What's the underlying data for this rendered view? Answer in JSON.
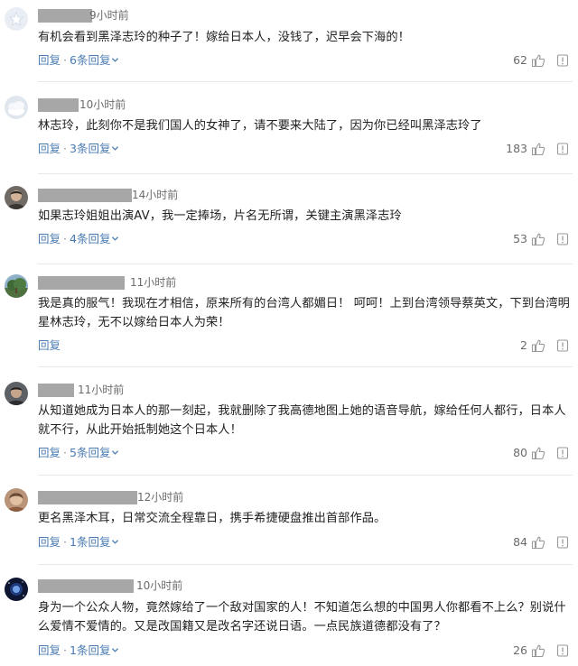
{
  "icons": {
    "like": "thumbs-up-icon",
    "report": "report-flag-icon",
    "expand": "chevron-down-icon"
  },
  "colors": {
    "link": "#4a7bb2",
    "name_mask": "#a7a7a7",
    "muted": "#6b6b6b"
  },
  "comments": [
    {
      "time": "9小时前",
      "text": "有机会看到黑泽志玲的种子了！嫁给日本人，没钱了，迟早会下海的！",
      "reply": "回复",
      "replies": "6条回复",
      "likes": "62"
    },
    {
      "time": "10小时前",
      "text": "林志玲，此刻你不是我们国人的女神了，请不要来大陆了，因为你已经叫黑泽志玲了",
      "reply": "回复",
      "replies": "3条回复",
      "likes": "183"
    },
    {
      "time": "14小时前",
      "text": "如果志玲姐姐出演AV，我一定捧场，片名无所谓，关键主演黑泽志玲",
      "reply": "回复",
      "replies": "4条回复",
      "likes": "53"
    },
    {
      "time": "11小时前",
      "text": "我是真的服气！我现在才相信，原来所有的台湾人都媚日！ 呵呵！上到台湾领导蔡英文，下到台湾明星林志玲，无不以嫁给日本人为荣！",
      "reply": "回复",
      "replies": "",
      "likes": "2"
    },
    {
      "time": "11小时前",
      "text": "从知道她成为日本人的那一刻起，我就删除了我高德地图上她的语音导航，嫁给任何人都行，日本人就不行，从此开始抵制她这个日本人！",
      "reply": "回复",
      "replies": "5条回复",
      "likes": "80"
    },
    {
      "time": "12小时前",
      "text": "更名黑泽木耳，日常交流全程靠日，携手希捷硬盘推出首部作品。",
      "reply": "回复",
      "replies": "1条回复",
      "likes": "84"
    },
    {
      "time": "10小时前",
      "text": "身为一个公众人物，竟然嫁给了一个敌对国家的人！不知道怎么想的中国男人你都看不上么？别说什么爱情不爱情的。又是改国籍又是改名字还说日语。一点民族道德都没有了？",
      "reply": "回复",
      "replies": "1条回复",
      "likes": "26"
    }
  ]
}
